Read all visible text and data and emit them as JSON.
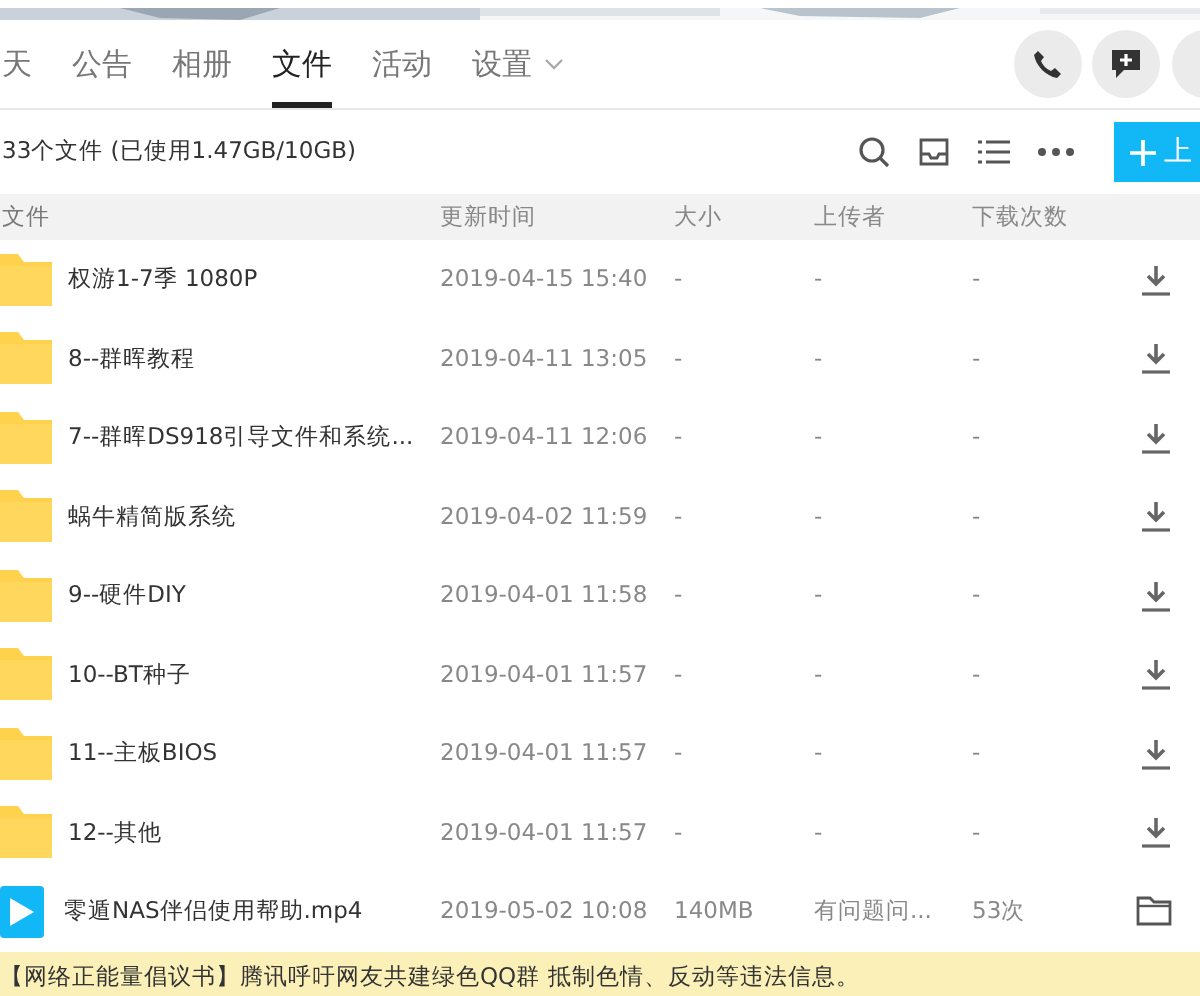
{
  "tabs": [
    {
      "label": "天",
      "selected": false,
      "dropdown": false
    },
    {
      "label": "公告",
      "selected": false,
      "dropdown": false
    },
    {
      "label": "相册",
      "selected": false,
      "dropdown": false
    },
    {
      "label": "文件",
      "selected": true,
      "dropdown": false
    },
    {
      "label": "活动",
      "selected": false,
      "dropdown": false
    },
    {
      "label": "设置",
      "selected": false,
      "dropdown": true
    }
  ],
  "summary": "33个文件 (已使用1.47GB/10GB)",
  "upload_button": "上",
  "table": {
    "columns": [
      "文件",
      "更新时间",
      "大小",
      "上传者",
      "下载次数"
    ],
    "rows": [
      {
        "kind": "folder",
        "name": "权游1-7季 1080P",
        "time": "2019-04-15 15:40",
        "size": "-",
        "uploader": "-",
        "downloads": "-"
      },
      {
        "kind": "folder",
        "name": "8--群晖教程",
        "time": "2019-04-11 13:05",
        "size": "-",
        "uploader": "-",
        "downloads": "-"
      },
      {
        "kind": "folder",
        "name": "7--群晖DS918引导文件和系统...",
        "time": "2019-04-11 12:06",
        "size": "-",
        "uploader": "-",
        "downloads": "-"
      },
      {
        "kind": "folder",
        "name": "蜗牛精简版系统",
        "time": "2019-04-02 11:59",
        "size": "-",
        "uploader": "-",
        "downloads": "-"
      },
      {
        "kind": "folder",
        "name": "9--硬件DIY",
        "time": "2019-04-01 11:58",
        "size": "-",
        "uploader": "-",
        "downloads": "-"
      },
      {
        "kind": "folder",
        "name": "10--BT种子",
        "time": "2019-04-01 11:57",
        "size": "-",
        "uploader": "-",
        "downloads": "-"
      },
      {
        "kind": "folder",
        "name": "11--主板BIOS",
        "time": "2019-04-01 11:57",
        "size": "-",
        "uploader": "-",
        "downloads": "-"
      },
      {
        "kind": "folder",
        "name": "12--其他",
        "time": "2019-04-01 11:57",
        "size": "-",
        "uploader": "-",
        "downloads": "-"
      },
      {
        "kind": "video",
        "name": "零遁NAS伴侣使用帮助.mp4",
        "time": "2019-05-02 10:08",
        "size": "140MB",
        "uploader": "有问题问...",
        "downloads": "53次"
      }
    ]
  },
  "notice": "【网络正能量倡议书】腾讯呼吁网友共建绿色QQ群 抵制色情、反动等违法信息。"
}
